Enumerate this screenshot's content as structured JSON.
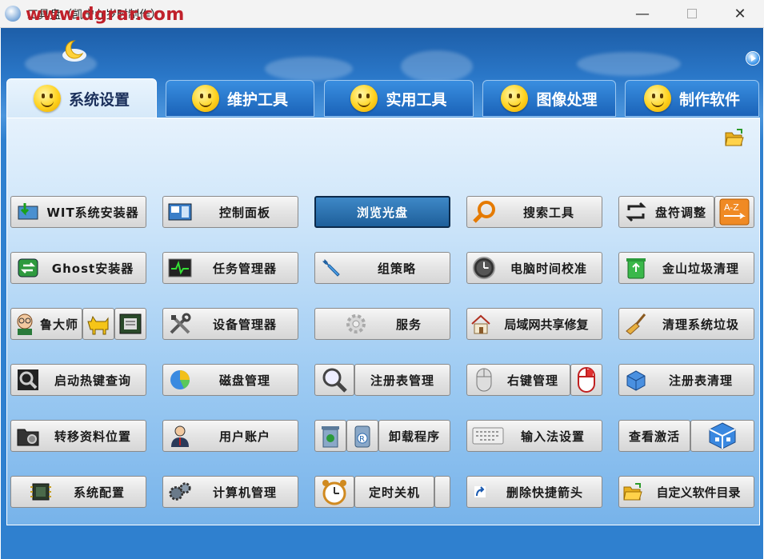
{
  "window": {
    "title": "工具盘（凯宁九岁时制作）",
    "watermark": "www.dgrar.com"
  },
  "tabs": [
    {
      "label": "系统设置",
      "active": true
    },
    {
      "label": "维护工具",
      "active": false
    },
    {
      "label": "实用工具",
      "active": false
    },
    {
      "label": "图像处理",
      "active": false
    },
    {
      "label": "制作软件",
      "active": false
    }
  ],
  "buttons": {
    "r1": [
      "WIT系统安装器",
      "控制面板",
      "浏览光盘",
      "搜索工具",
      "盘符调整"
    ],
    "r2": [
      "Ghost安装器",
      "任务管理器",
      "组策略",
      "电脑时间校准",
      "金山垃圾清理"
    ],
    "r3": [
      "鲁大师",
      "设备管理器",
      "服务",
      "局域网共享修复",
      "清理系统垃圾"
    ],
    "r4": [
      "启动热键查询",
      "磁盘管理",
      "注册表管理",
      "右键管理",
      "注册表清理"
    ],
    "r5": [
      "转移资料位置",
      "用户账户",
      "卸载程序",
      "输入法设置",
      "查看激活"
    ],
    "r6": [
      "系统配置",
      "计算机管理",
      "定时关机",
      "删除快捷箭头",
      "自定义软件目录"
    ]
  },
  "colors": {
    "accent": "#2a77c8",
    "active_button": "#1e5f9a"
  }
}
